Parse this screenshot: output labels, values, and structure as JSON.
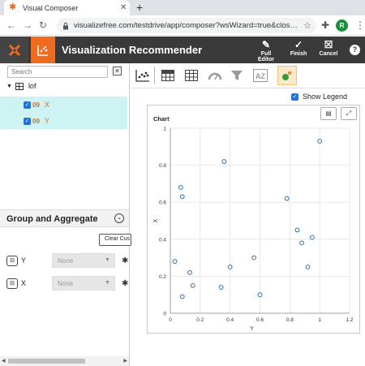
{
  "browser": {
    "tab_title": "Visual Composer",
    "url": "visualizefree.com/testdrive/app/composer?wsWizard=true&clos…",
    "profile_initial": "R"
  },
  "header": {
    "title": "Visualization Recommender",
    "full_editor": "Full Editor",
    "finish": "Finish",
    "cancel": "Cancel",
    "help": "?"
  },
  "left_panel": {
    "search_placeholder": "Search",
    "table_name": "lof",
    "fields": [
      {
        "type": "09",
        "name": "X",
        "checked": true
      },
      {
        "type": "09",
        "name": "Y",
        "checked": true
      }
    ],
    "group_aggregate_title": "Group and Aggregate",
    "clear_button": "Clear Cus",
    "aggregations": [
      {
        "label": "Y",
        "value": "None"
      },
      {
        "label": "X",
        "value": "None"
      }
    ]
  },
  "toolbar": {
    "show_legend": "Show Legend"
  },
  "chart": {
    "title": "Chart"
  },
  "chart_data": {
    "type": "scatter",
    "title": "Chart",
    "xlabel": "Y",
    "ylabel": "X",
    "xlim": [
      0,
      1.2
    ],
    "ylim": [
      0,
      1
    ],
    "xticks": [
      "0",
      "0.2",
      "0.4",
      "0.6",
      "0.8",
      "1",
      "1.2"
    ],
    "yticks": [
      "0",
      "0.2",
      "0.4",
      "0.6",
      "0.8",
      "1"
    ],
    "grid": true,
    "points": [
      {
        "x": 0.03,
        "y": 0.28
      },
      {
        "x": 0.07,
        "y": 0.68
      },
      {
        "x": 0.08,
        "y": 0.63
      },
      {
        "x": 0.08,
        "y": 0.09
      },
      {
        "x": 0.13,
        "y": 0.22
      },
      {
        "x": 0.15,
        "y": 0.15
      },
      {
        "x": 0.34,
        "y": 0.14
      },
      {
        "x": 0.36,
        "y": 0.82
      },
      {
        "x": 0.4,
        "y": 0.25
      },
      {
        "x": 0.56,
        "y": 0.3
      },
      {
        "x": 0.6,
        "y": 0.1
      },
      {
        "x": 0.78,
        "y": 0.62
      },
      {
        "x": 0.85,
        "y": 0.45
      },
      {
        "x": 0.88,
        "y": 0.38
      },
      {
        "x": 0.92,
        "y": 0.25
      },
      {
        "x": 0.95,
        "y": 0.41
      },
      {
        "x": 1.0,
        "y": 0.93
      }
    ],
    "marker_color": "#2c6fb5"
  }
}
